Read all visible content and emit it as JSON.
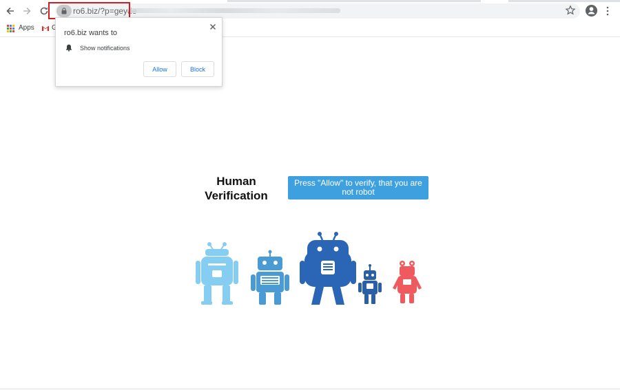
{
  "browser": {
    "url_host": "ro6.biz/?p=geyde",
    "url_obscured": true,
    "icons": [
      "back-arrow-icon",
      "forward-arrow-icon",
      "reload-icon",
      "lock-icon",
      "star-icon",
      "account-icon",
      "more-menu-icon"
    ]
  },
  "bookmarks": {
    "apps_label": "Apps",
    "gmail_label": "G"
  },
  "permission_popup": {
    "title": "ro6.biz wants to",
    "permission": "Show notifications",
    "allow_label": "Allow",
    "block_label": "Block"
  },
  "page": {
    "heading_line1": "Human",
    "heading_line2": "Verification",
    "cta_text": "Press \"Allow\" to verify, that you are not robot",
    "cta_color": "#3fa0e0",
    "robot_colors": [
      "#86cdf2",
      "#4a9ad4",
      "#2a66b5",
      "#2a5fa5",
      "#ef5a5f"
    ]
  },
  "colors": {
    "highlight": "#d71920",
    "link_blue": "#1a73e8"
  }
}
